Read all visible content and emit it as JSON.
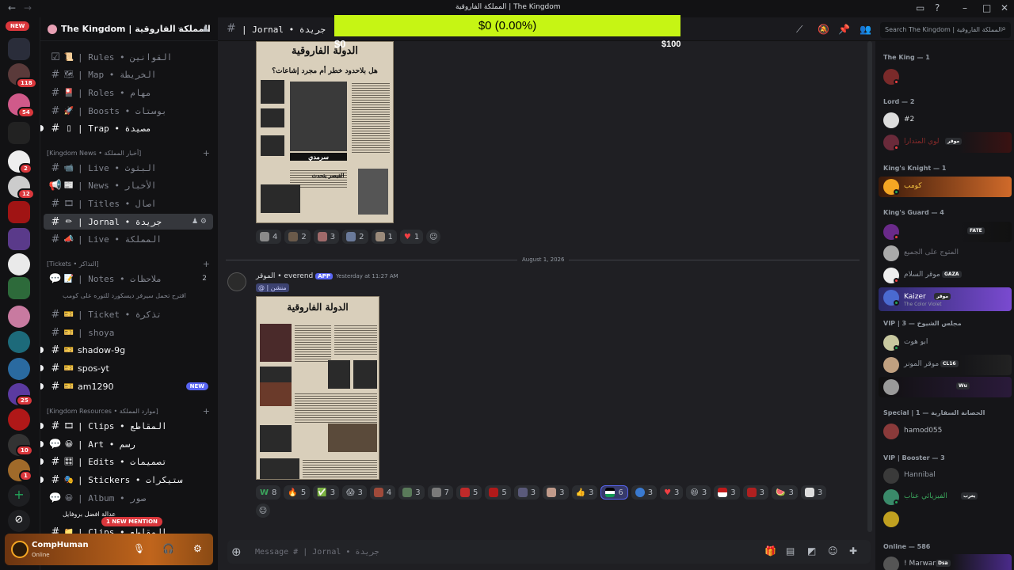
{
  "window": {
    "title": "المملكة الفاروقية | The Kingdom",
    "back_glyph": "←",
    "forward_glyph": "→"
  },
  "donation": {
    "amount": "$0 (0.00%)",
    "min": "$0",
    "max": "$100",
    "progress": 0
  },
  "rail": {
    "new_label": "NEW",
    "badges": [
      "118",
      "54",
      "2",
      "12",
      "25",
      "10",
      "1"
    ]
  },
  "server": {
    "name": "The Kingdom | المملكة الفاروقية"
  },
  "channels": {
    "rules": "| Rules • القوانين",
    "map": "| Map • الخريطة",
    "roles": "| Roles • مهام",
    "boosts": "| Boosts • بوستات",
    "trap": "| Trap • مصيدة",
    "cat_news": "[Kingdom News • أخبار المملكة]",
    "live": "| Live • البثوث",
    "news": "| News • الأخبار",
    "titles": "| Titles • اصال",
    "jornal": "| Jornal • جريدة",
    "live2": "| Live • المملكة",
    "cat_tickets": "[Tickets • التذاكر]",
    "notes": "| Notes • ملاحظات",
    "notes_count": "2",
    "notes_thread": "اقترح تحمل سيرفر ديسكورد للتوره على كومب",
    "ticket": "| Ticket • تذكرة",
    "shoya": "| shoya",
    "shadow": "shadow-9g",
    "spos": "spos-yt",
    "am": "am1290",
    "am_new": "NEW",
    "cat_resources": "[Kingdom Resources • موارد المملكة]",
    "clips": "| Clips • المقاطع",
    "art": "| Art • رسم",
    "edits": "| Edits • تصميمات",
    "stickers": "| Stickers • ستيكرات",
    "album": "| Album • صور",
    "album_thread": "عدالة افضل بروفايل",
    "clips2": "| Clips • المقاطع",
    "mention_pill": "1 NEW MENTION"
  },
  "user": {
    "name": "CompHuman",
    "status": "Online"
  },
  "chat": {
    "channel_name": "| Jornal • جريدة",
    "search_placeholder": "Search The Kingdom | المملكة الفاروقية",
    "paper1_title": "الدولة الفاروقية",
    "paper1_headline": "هل بلاحدود خطر أم مجرد إشاعات؟",
    "paper1_caption": "سرمدي",
    "paper1_sub": "القيصر يتحدث",
    "reactions1": [
      "4",
      "2",
      "3",
      "2",
      "1",
      "1"
    ],
    "date_divider": "August 1, 2026",
    "author": "الموقر • everend",
    "app_tag": "APP",
    "timestamp": "Yesterday at 11:27 AM",
    "mention": "@ | منشن",
    "paper2_title": "الدولة الفاروقية",
    "reactions2": [
      "8",
      "5",
      "3",
      "3",
      "4",
      "3",
      "7",
      "5",
      "5",
      "3",
      "3",
      "3",
      "6",
      "3",
      "3",
      "3",
      "3",
      "3",
      "3",
      "3"
    ],
    "composer_placeholder": "Message # | Jornal • جريدة"
  },
  "members": {
    "groups": [
      {
        "title": "The King — 1"
      },
      {
        "title": "Lord — 2"
      },
      {
        "title": "King's Knight — 1"
      },
      {
        "title": "King's Guard — 4"
      },
      {
        "title": "VIP | مجلس الشيوخ — 3"
      },
      {
        "title": "Special | الحصانة السفارية — 1"
      },
      {
        "title": "VIP | Booster — 3"
      },
      {
        "title": "Online — 586"
      }
    ],
    "list": [
      {
        "name": "",
        "tag": ""
      },
      {
        "name": "#2",
        "tag": ""
      },
      {
        "name": "لوي المتدارا",
        "tag": "موقر"
      },
      {
        "name": "كومب",
        "tag": ""
      },
      {
        "name": "",
        "tag": "FATE"
      },
      {
        "name": "المتوج على الجميع",
        "tag": ""
      },
      {
        "name": "موقر السلام",
        "tag": "GAZA"
      },
      {
        "name": "Kaizer",
        "tag": "موقر",
        "sub": "The Color Violet"
      },
      {
        "name": "ابو هوت",
        "tag": ""
      },
      {
        "name": "موقر المونر",
        "tag": "CL16"
      },
      {
        "name": "",
        "tag": "Wu"
      },
      {
        "name": "hamod055",
        "tag": ""
      },
      {
        "name": "Hannibal",
        "tag": ""
      },
      {
        "name": "الفيزيائي عناب",
        "tag": "يعرب"
      },
      {
        "name": "",
        "tag": ""
      },
      {
        "name": "! Marwan",
        "tag": "Dsa"
      }
    ]
  },
  "colors": {
    "accent": "#5865f2",
    "donation_bar": "#c6f514",
    "danger": "#da373c",
    "online": "#23a55a"
  }
}
